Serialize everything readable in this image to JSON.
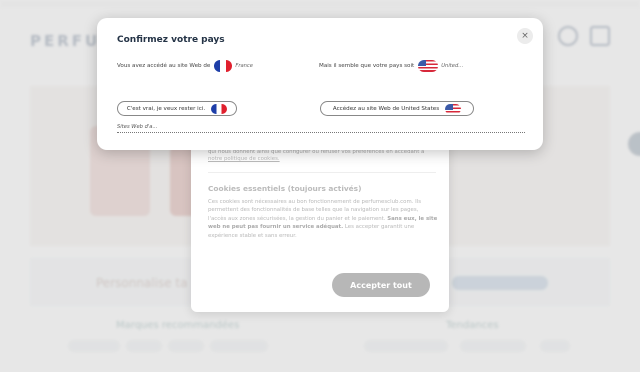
{
  "site": {
    "brand": "PERFUM",
    "promo_text": "Personnalise ta",
    "section_brands": "Marques recommandées",
    "section_trends": "Tendances"
  },
  "cookie": {
    "text1_a": "qui nous donnent ainsi que configurer ou refuser vos préférences en accédant à",
    "text1_link": "notre politique de cookies.",
    "title": "Cookies essentiels (toujours activés)",
    "text2_a": "Ces cookies sont nécessaires au bon fonctionnement de perfumesclub.com. Ils permettent des fonctionnalités de base telles que la navigation sur les pages, l'accès aux zones sécurisées, la gestion du panier et le paiement.",
    "text2_bold": "Sans eux, le site web ne peut pas fournir un service adéquat.",
    "text2_b": "Les accepter garantit une expérience stable et sans erreur.",
    "accept_label": "Accepter tout"
  },
  "modal": {
    "title": "Confirmez votre pays",
    "close_symbol": "×",
    "left_text": "Vous avez accédé au site Web de",
    "left_country": "France",
    "right_text": "Mais il semble que votre pays soit",
    "right_country": "United...",
    "stay_label": "C'est vrai, je veux rester ici.",
    "go_label": "Accédez au site Web de United States",
    "other_placeholder": "Sites Web d'a..."
  },
  "icons": {
    "left_flag": "france-flag-icon",
    "right_flag": "usa-flag-icon",
    "close": "close-icon"
  },
  "colors": {
    "title": "#243346",
    "accept_button": "#b7b7b7",
    "overlay": "rgba(120,120,120,.18)"
  }
}
